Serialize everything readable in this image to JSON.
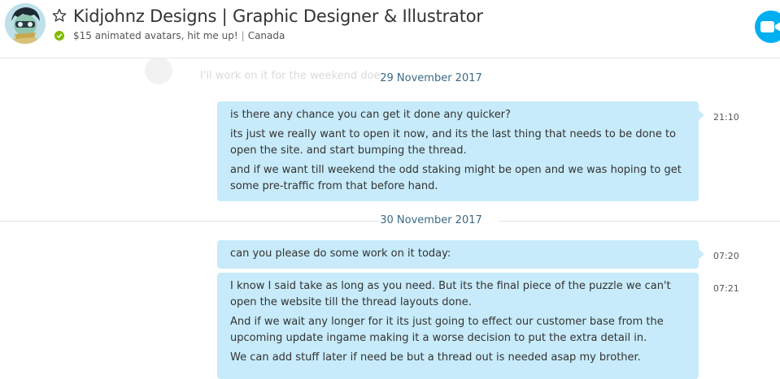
{
  "header": {
    "contact_name": "Kidjohnz Designs | Graphic Designer & Illustrator",
    "mood": "$15 animated avatars, hit me up!",
    "separator": "|",
    "location": "Canada",
    "status_color": "#7fba00",
    "accent_color": "#00aff0",
    "icons": [
      "avatar",
      "star-icon",
      "online-status-icon",
      "video-call-icon"
    ]
  },
  "chat": {
    "faded_message": "I'll work on it for the weekend doe",
    "dates": [
      "29 November 2017",
      "30 November 2017"
    ],
    "messages": [
      {
        "time": "21:10",
        "paragraphs": [
          "is there any chance you can get it done any quicker?",
          "its just we really want to open it now, and its the last thing that needs to be done to open the site. and start bumping the thread.",
          "and if we want till weekend the odd staking might be open and we was hoping to get some pre-traffic from that before hand."
        ]
      },
      {
        "time": "07:20",
        "paragraphs": [
          "can you please do some work on it today:"
        ]
      },
      {
        "time": "07:21",
        "paragraphs": [
          "I know I said take as long as you need. But its the final piece of the puzzle we can't open the website till the thread layouts done.",
          "And if we wait any longer for it its just going to effect our customer base from the upcoming update ingame making it a worse decision to put the extra detail in.",
          "We can add stuff later if need be but a thread out is needed asap my brother."
        ]
      }
    ],
    "bubble_color": "#c7ebfa"
  }
}
